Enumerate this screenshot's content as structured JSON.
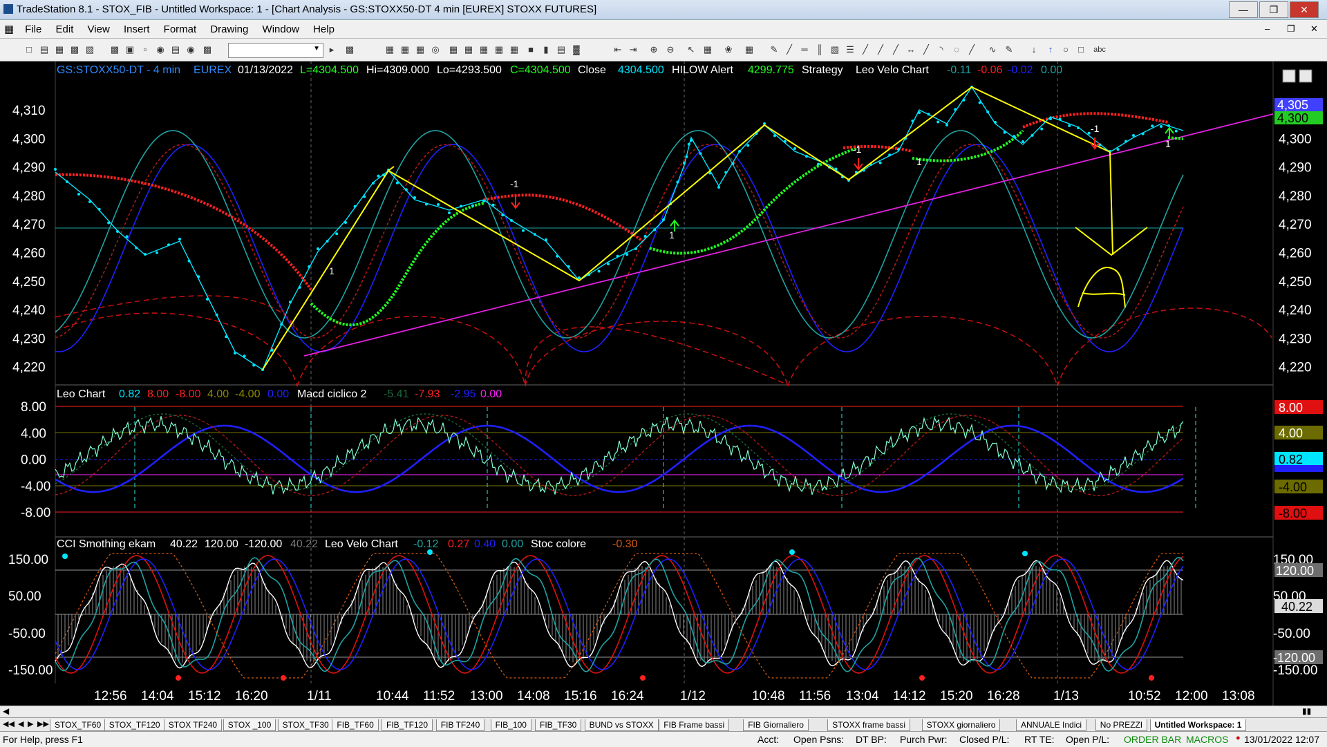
{
  "window": {
    "title": "TradeStation 8.1 - STOX_FIB - Untitled Workspace:  1 - [Chart Analysis - GS:STOXX50-DT  4 min  [EUREX] STOXX FUTURES]"
  },
  "menu": [
    "File",
    "Edit",
    "View",
    "Insert",
    "Format",
    "Drawing",
    "Window",
    "Help"
  ],
  "chart_header": {
    "symbol": "GS:STOXX50-DT - 4 min",
    "exchange": "EUREX",
    "date": "01/13/2022",
    "L": "L=4304.500",
    "Hi": "Hi=4309.000",
    "Lo": "Lo=4293.500",
    "C": "C=4304.500",
    "close_label": "Close",
    "close_val": "4304.500",
    "hilow_label": "HILOW Alert",
    "hilow_val": "4299.775",
    "strategy": "Strategy",
    "leo_velo": "Leo Velo Chart",
    "lv1": "-0.11",
    "lv2": "-0.06",
    "lv3": "-0.02",
    "lv4": "0.00"
  },
  "panel2_header": {
    "leo": "Leo Chart",
    "v1": "0.82",
    "v2": "8.00",
    "v3": "-8.00",
    "v4": "4.00",
    "v5": "-4.00",
    "v6": "0.00",
    "macd": "Macd ciclico 2",
    "m1": "-5.41",
    "m2": "-7.93",
    "m3": "-2.95",
    "m4": "0.00"
  },
  "panel3_header": {
    "cci": "CCI Smothing ekam",
    "c1": "40.22",
    "c2": "120.00",
    "c3": "-120.00",
    "c4": "40.22",
    "lvc": "Leo Velo Chart",
    "l1": "-0.12",
    "l2": "0.27",
    "l3": "0.40",
    "l4": "0.00",
    "stoc": "Stoc colore",
    "s1": "-0.30"
  },
  "price_axis": [
    "4,310",
    "4,300",
    "4,290",
    "4,280",
    "4,270",
    "4,260",
    "4,250",
    "4,240",
    "4,230",
    "4,220"
  ],
  "price_badges": {
    "blue": "4,305",
    "green": "4,300"
  },
  "macd_axis": [
    "8.00",
    "4.00",
    "0.00",
    "-4.00",
    "-8.00"
  ],
  "macd_badges": {
    "red_top": "8.00",
    "olive": "4.00",
    "cyan": "0.82",
    "olive2": "-4.00",
    "red_bot": "-8.00"
  },
  "cci_axis": [
    "150.00",
    "50.00",
    "-50.00",
    "-150.00"
  ],
  "cci_badges": {
    "b1": "150.00",
    "b2": "120.00",
    "b3": "40.22",
    "b4": "-50.00",
    "b5": "-120.00",
    "b6": "-150.00"
  },
  "time_axis": [
    "12:56",
    "14:04",
    "15:12",
    "16:20",
    "1/11",
    "10:44",
    "11:52",
    "13:00",
    "14:08",
    "15:16",
    "16:24",
    "1/12",
    "10:48",
    "11:56",
    "13:04",
    "14:12",
    "15:20",
    "16:28",
    "1/13",
    "10:52",
    "12:00",
    "13:08"
  ],
  "annotations": {
    "marker_pos": "1",
    "marker_neg": "-1",
    "handwritten": "A"
  },
  "tabs": [
    "STOX_TF60",
    "STOX_TF120",
    "STOX TF240",
    "STOX _100",
    "STOX_TF30",
    "FIB_TF60",
    "FIB_TF120",
    "FIB TF240",
    "FIB_100",
    "FIB_TF30",
    "BUND vs STOXX",
    "FIB Frame bassi",
    "FIB Giornaliero",
    "STOXX frame bassi",
    "STOXX giornaliero",
    "ANNUALE Indici",
    "No PREZZI",
    "Untitled Workspace:  1"
  ],
  "status": {
    "help": "For Help, press F1",
    "acct": "Acct:",
    "open_psns": "Open Psns:",
    "dt_bp": "DT BP:",
    "purch_pwr": "Purch Pwr:",
    "closed_pl": "Closed P/L:",
    "rt_te": "RT TE:",
    "open_pl": "Open P/L:",
    "order_bar": "ORDER BAR",
    "macros": "MACROS",
    "datetime": "13/01/2022 12:07"
  },
  "colors": {
    "bg": "#000000",
    "yellow": "#ffff00",
    "magenta": "#e020e0",
    "cyan": "#00e5ff",
    "red": "#ff2020",
    "green": "#20ff20",
    "blue": "#2020ff",
    "teal": "#1fa3a3"
  }
}
